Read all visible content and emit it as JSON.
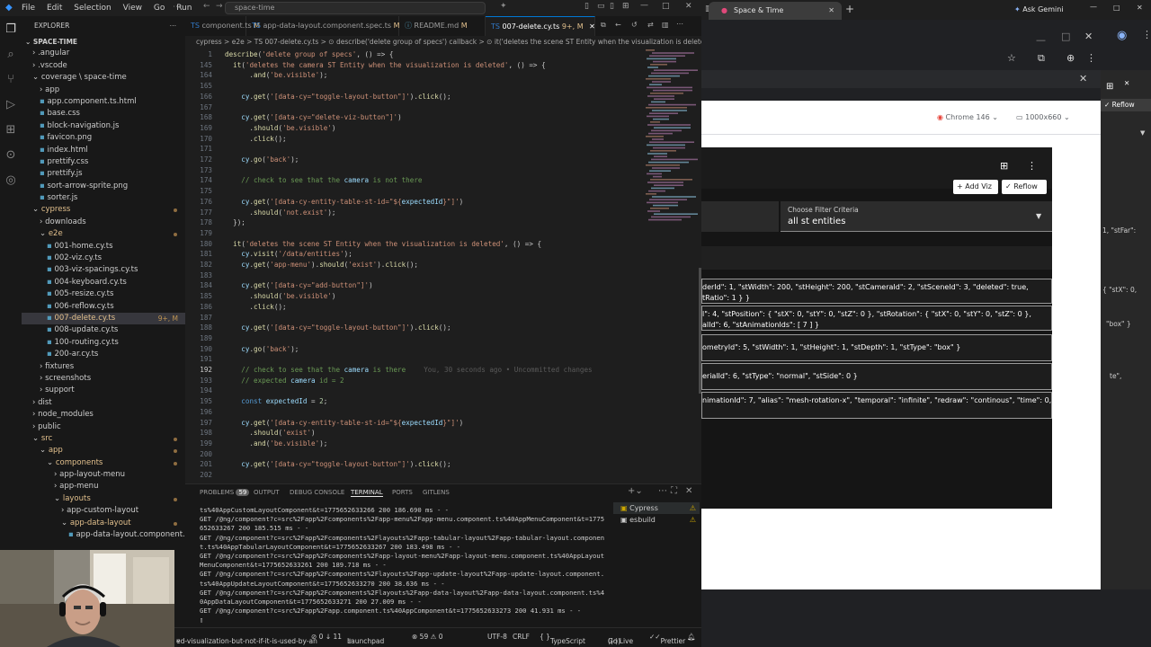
{
  "titlebar": {
    "menus": [
      "File",
      "Edit",
      "Selection",
      "View",
      "Go",
      "Run"
    ],
    "search": "space-time"
  },
  "explorer": {
    "header": "EXPLORER",
    "project": "SPACE-TIME",
    "items": [
      {
        "label": ".angular",
        "indent": 1,
        "kind": "folder"
      },
      {
        "label": ".vscode",
        "indent": 1,
        "kind": "folder"
      },
      {
        "label": "coverage \\ space-time",
        "indent": 1,
        "kind": "folder-open"
      },
      {
        "label": "app",
        "indent": 2,
        "kind": "folder"
      },
      {
        "label": "app.component.ts.html",
        "indent": 2,
        "kind": "file"
      },
      {
        "label": "base.css",
        "indent": 2,
        "kind": "file"
      },
      {
        "label": "block-navigation.js",
        "indent": 2,
        "kind": "file"
      },
      {
        "label": "favicon.png",
        "indent": 2,
        "kind": "file"
      },
      {
        "label": "index.html",
        "indent": 2,
        "kind": "file"
      },
      {
        "label": "prettify.css",
        "indent": 2,
        "kind": "file"
      },
      {
        "label": "prettify.js",
        "indent": 2,
        "kind": "file"
      },
      {
        "label": "sort-arrow-sprite.png",
        "indent": 2,
        "kind": "file"
      },
      {
        "label": "sorter.js",
        "indent": 2,
        "kind": "file"
      },
      {
        "label": "cypress",
        "indent": 1,
        "kind": "folder-open",
        "mod": true
      },
      {
        "label": "downloads",
        "indent": 2,
        "kind": "folder"
      },
      {
        "label": "e2e",
        "indent": 2,
        "kind": "folder-open",
        "mod": true
      },
      {
        "label": "001-home.cy.ts",
        "indent": 3,
        "kind": "file"
      },
      {
        "label": "002-viz.cy.ts",
        "indent": 3,
        "kind": "file"
      },
      {
        "label": "003-viz-spacings.cy.ts",
        "indent": 3,
        "kind": "file"
      },
      {
        "label": "004-keyboard.cy.ts",
        "indent": 3,
        "kind": "file"
      },
      {
        "label": "005-resize.cy.ts",
        "indent": 3,
        "kind": "file"
      },
      {
        "label": "006-reflow.cy.ts",
        "indent": 3,
        "kind": "file"
      },
      {
        "label": "007-delete.cy.ts",
        "indent": 3,
        "kind": "file",
        "selected": true,
        "badge": "9+, M"
      },
      {
        "label": "008-update.cy.ts",
        "indent": 3,
        "kind": "file"
      },
      {
        "label": "100-routing.cy.ts",
        "indent": 3,
        "kind": "file"
      },
      {
        "label": "200-ar.cy.ts",
        "indent": 3,
        "kind": "file"
      },
      {
        "label": "fixtures",
        "indent": 2,
        "kind": "folder"
      },
      {
        "label": "screenshots",
        "indent": 2,
        "kind": "folder"
      },
      {
        "label": "support",
        "indent": 2,
        "kind": "folder"
      },
      {
        "label": "dist",
        "indent": 1,
        "kind": "folder"
      },
      {
        "label": "node_modules",
        "indent": 1,
        "kind": "folder"
      },
      {
        "label": "public",
        "indent": 1,
        "kind": "folder"
      },
      {
        "label": "src",
        "indent": 1,
        "kind": "folder-open",
        "mod": true
      },
      {
        "label": "app",
        "indent": 2,
        "kind": "folder-open",
        "mod": true
      },
      {
        "label": "components",
        "indent": 3,
        "kind": "folder-open",
        "mod": true
      },
      {
        "label": "app-layout-menu",
        "indent": 4,
        "kind": "folder"
      },
      {
        "label": "app-menu",
        "indent": 4,
        "kind": "folder"
      },
      {
        "label": "layouts",
        "indent": 4,
        "kind": "folder-open",
        "mod": true
      },
      {
        "label": "app-custom-layout",
        "indent": 5,
        "kind": "folder"
      },
      {
        "label": "app-data-layout",
        "indent": 5,
        "kind": "folder-open",
        "mod": true
      },
      {
        "label": "app-data-layout.component.html",
        "indent": 6,
        "kind": "file"
      }
    ]
  },
  "tabs": [
    {
      "label": "component.ts",
      "suffix": "M"
    },
    {
      "label": "app-data-layout.component.spec.ts",
      "suffix": "M"
    },
    {
      "label": "README.md",
      "suffix": "M"
    },
    {
      "label": "007-delete.cy.ts",
      "suffix": "9+, M",
      "active": true
    }
  ],
  "breadcrumb": "cypress > e2e > TS 007-delete.cy.ts > ⊙ describe('delete group of specs') callback > ⊙ it('deletes the scene ST Entity when the visualization is deleted') callback",
  "code_lines": [
    {
      "n": "1",
      "t": "describe('delete group of specs', () => {"
    },
    {
      "n": "145",
      "t": "  it('deletes the camera ST Entity when the visualization is deleted', () => {"
    },
    {
      "n": "164",
      "t": "      .and('be.visible');"
    },
    {
      "n": "165",
      "t": ""
    },
    {
      "n": "166",
      "t": "    cy.get('[data-cy=\"toggle-layout-button\"]').click();"
    },
    {
      "n": "167",
      "t": ""
    },
    {
      "n": "168",
      "t": "    cy.get('[data-cy=\"delete-viz-button\"]')"
    },
    {
      "n": "169",
      "t": "      .should('be.visible')"
    },
    {
      "n": "170",
      "t": "      .click();"
    },
    {
      "n": "171",
      "t": ""
    },
    {
      "n": "172",
      "t": "    cy.go('back');"
    },
    {
      "n": "173",
      "t": ""
    },
    {
      "n": "174",
      "t": "    // check to see that the camera is not there"
    },
    {
      "n": "175",
      "t": ""
    },
    {
      "n": "176",
      "t": "    cy.get('[data-cy-entity-table-st-id=\"${expectedId}\"]')"
    },
    {
      "n": "177",
      "t": "      .should('not.exist');"
    },
    {
      "n": "178",
      "t": "  });"
    },
    {
      "n": "179",
      "t": ""
    },
    {
      "n": "180",
      "t": "  it('deletes the scene ST Entity when the visualization is deleted', () => {"
    },
    {
      "n": "181",
      "t": "    cy.visit('/data/entities');"
    },
    {
      "n": "182",
      "t": "    cy.get('app-menu').should('exist').click();"
    },
    {
      "n": "183",
      "t": ""
    },
    {
      "n": "184",
      "t": "    cy.get('[data-cy=\"add-button\"]')"
    },
    {
      "n": "185",
      "t": "      .should('be.visible')"
    },
    {
      "n": "186",
      "t": "      .click();"
    },
    {
      "n": "187",
      "t": ""
    },
    {
      "n": "188",
      "t": "    cy.get('[data-cy=\"toggle-layout-button\"]').click();"
    },
    {
      "n": "189",
      "t": ""
    },
    {
      "n": "190",
      "t": "    cy.go('back');"
    },
    {
      "n": "191",
      "t": ""
    },
    {
      "n": "192",
      "t": "    // check to see that the camera is there",
      "blame": "You, 30 seconds ago • Uncommitted changes"
    },
    {
      "n": "193",
      "t": "    // expected camera id = 2"
    },
    {
      "n": "194",
      "t": ""
    },
    {
      "n": "195",
      "t": "    const expectedId = 2;"
    },
    {
      "n": "196",
      "t": ""
    },
    {
      "n": "197",
      "t": "    cy.get('[data-cy-entity-table-st-id=\"${expectedId}\"]')"
    },
    {
      "n": "198",
      "t": "      .should('exist')"
    },
    {
      "n": "199",
      "t": "      .and('be.visible');"
    },
    {
      "n": "200",
      "t": ""
    },
    {
      "n": "201",
      "t": "    cy.get('[data-cy=\"toggle-layout-button\"]').click();"
    },
    {
      "n": "202",
      "t": ""
    }
  ],
  "panel": {
    "tabs": [
      "PROBLEMS",
      "OUTPUT",
      "DEBUG CONSOLE",
      "TERMINAL",
      "PORTS",
      "GITLENS"
    ],
    "problems_count": "59",
    "active_tab": "TERMINAL",
    "terminal_lines": [
      "ts%40AppCustomLayoutComponent&t=1775652633266 200 186.690 ms - -",
      "GET /@ng/component?c=src%2Fapp%2Fcomponents%2Fapp-menu%2Fapp-menu.component.ts%40AppMenuComponent&t=1775",
      "652633267 200 185.515 ms - -",
      "GET /@ng/component?c=src%2Fapp%2Fcomponents%2Flayouts%2Fapp-tabular-layout%2Fapp-tabular-layout.componen",
      "t.ts%40AppTabularLayoutComponent&t=1775652633267 200 183.498 ms - -",
      "GET /@ng/component?c=src%2Fapp%2Fcomponents%2Fapp-layout-menu%2Fapp-layout-menu.component.ts%40AppLayout",
      "MenuComponent&t=1775652633261 200 189.718 ms - -",
      "GET /@ng/component?c=src%2Fapp%2Fcomponents%2Flayouts%2Fapp-update-layout%2Fapp-update-layout.component.",
      "ts%40AppUpdateLayoutComponent&t=1775652633270 200 38.636 ms - -",
      "GET /@ng/component?c=src%2Fapp%2Fcomponents%2Flayouts%2Fapp-data-layout%2Fapp-data-layout.component.ts%4",
      "0AppDataLayoutComponent&t=1775652633271 200 27.009 ms - -",
      "GET /@ng/component?c=src%2Fapp%2Fapp.component.ts%40AppComponent&t=1775652633273 200 41.931 ms - -"
    ],
    "terminals": [
      "Cypress",
      "esbuild"
    ]
  },
  "statusbar": {
    "branch": "ed-visualization-but-not-if-it-is-used-by-an",
    "sync": "⊘ 0 ↓ 11",
    "launchpad": "Launchpad",
    "errors": "⊗ 59 ⚠ 0",
    "encoding": "UTF-8",
    "eol": "CRLF",
    "lang": "TypeScript",
    "golive": "Go Live",
    "prettier": "Prettier"
  },
  "browser": {
    "tab_title": "Space & Time",
    "gemini": "Ask Gemini",
    "reflow_top": "Reflow",
    "device_browser": "Chrome 146",
    "device_size": "1000x660",
    "app": {
      "add_viz": "Add Viz",
      "reflow": "Reflow",
      "filter_label": "Choose Filter Criteria",
      "filter_value": "all st entities",
      "rows": [
        [
          "derId\": 1, \"stWidth\": 200, \"stHeight\": 200, \"stCameraId\": 2, \"stSceneId\": 3, \"deleted\": true,",
          "tRatio\": 1 } }"
        ],
        [
          "l\": 4, \"stPosition\": { \"stX\": 0, \"stY\": 0, \"stZ\": 0 }, \"stRotation\": { \"stX\": 0, \"stY\": 0, \"stZ\": 0 },",
          "alId\": 6, \"stAnimationIds\": [ 7 ] }"
        ],
        [
          "ometryId\": 5, \"stWidth\": 1, \"stHeight\": 1, \"stDepth\": 1, \"stType\": \"box\" }"
        ],
        [
          "erialId\": 6, \"stType\": \"normal\", \"stSide\": 0 }"
        ],
        [
          "nimationId\": 7, \"alias\": \"mesh-rotation-x\", \"temporal\": \"infinite\", \"redraw\": \"continous\", \"time\": 0,"
        ]
      ]
    },
    "side_panel": [
      "1, \"stFar\":",
      "{ \"stX\": 0,",
      "\"box\" }",
      "te\","
    ]
  }
}
